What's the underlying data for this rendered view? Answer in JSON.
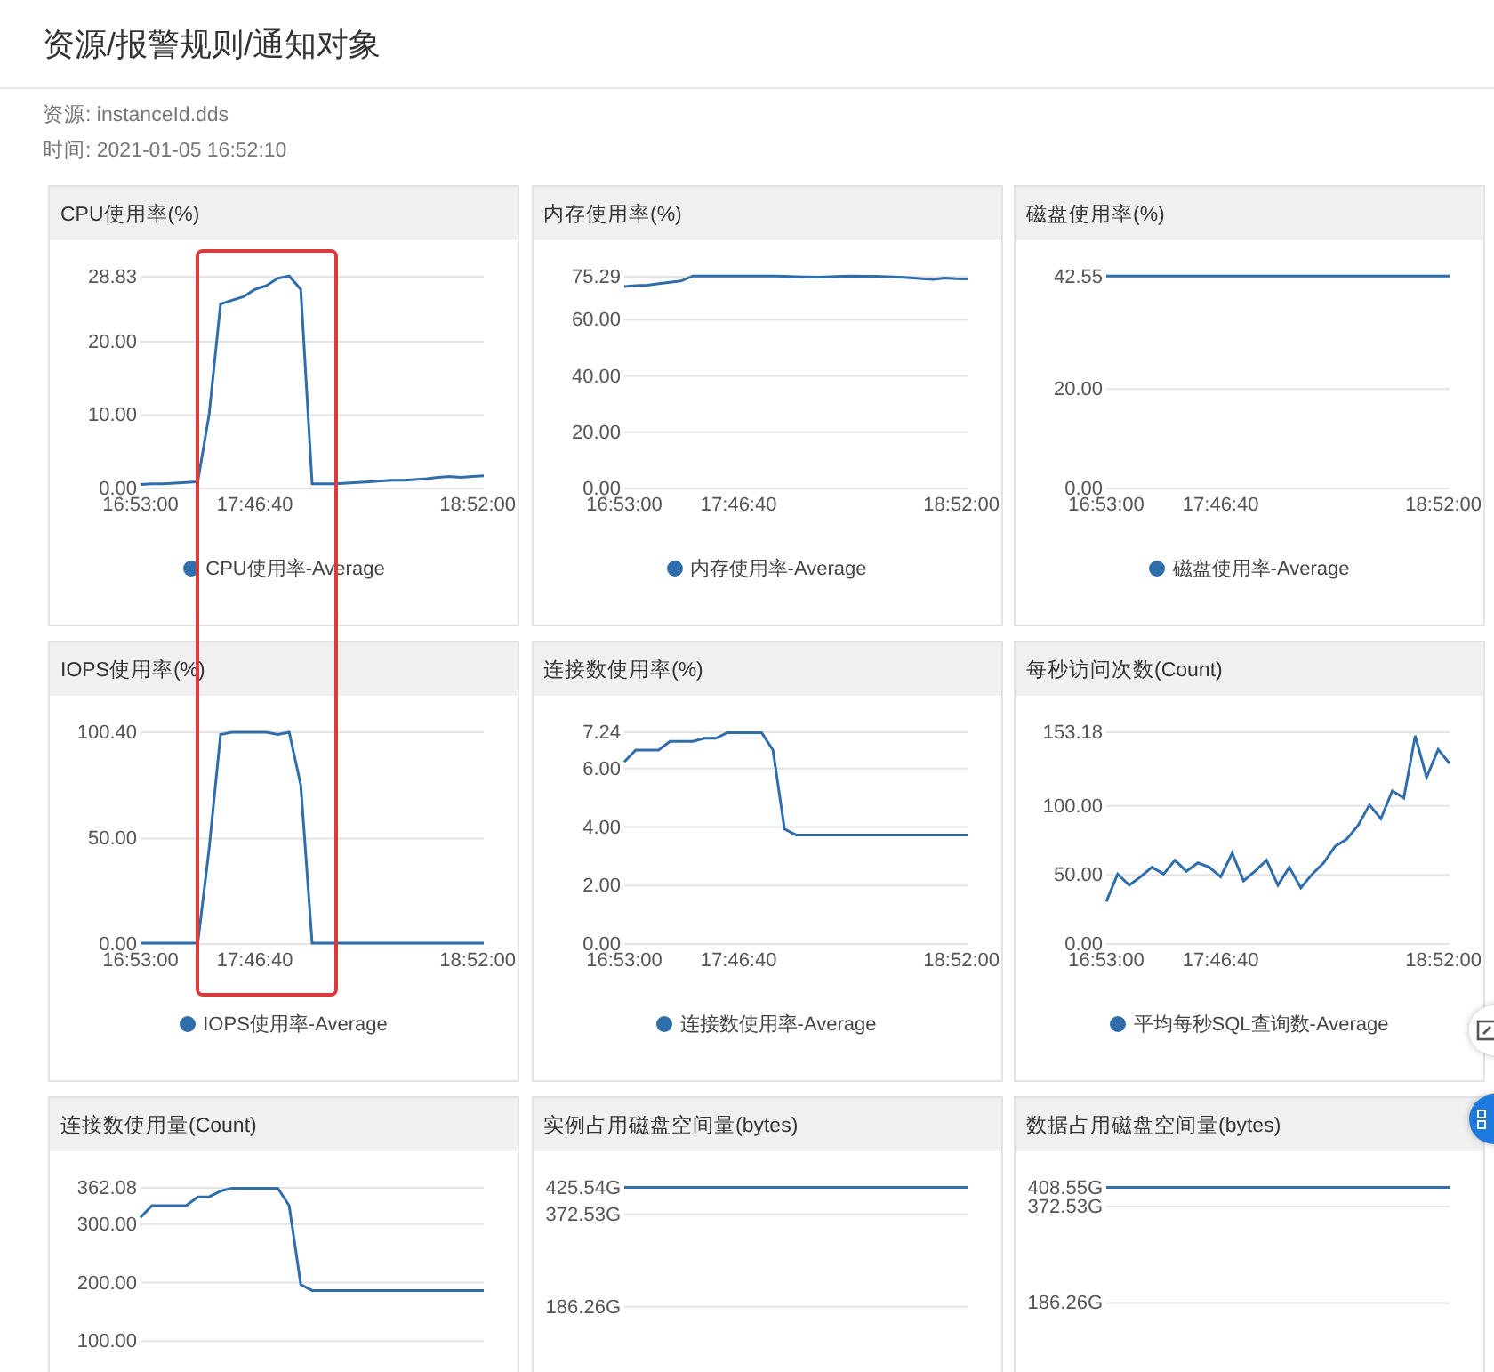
{
  "page_title": "资源/报警规则/通知对象",
  "meta": [
    "资源: instanceId.dds",
    "时间: 2021-01-05 16:52:10"
  ],
  "charts": [
    {
      "title": "CPU使用率(%)",
      "chart_data": {
        "type": "line",
        "grid": true,
        "categories": [
          "16:53:00",
          null,
          null,
          null,
          null,
          null,
          null,
          null,
          null,
          null,
          "17:46:40",
          null,
          null,
          null,
          null,
          null,
          null,
          null,
          null,
          null,
          null,
          null,
          null,
          null,
          null,
          null,
          null,
          null,
          null,
          null,
          "18:52:00"
        ],
        "ylim": [
          0,
          28.83
        ],
        "yticks": [
          {
            "value": 0,
            "label": "0.00"
          },
          {
            "value": 10,
            "label": "10.00"
          },
          {
            "value": 20,
            "label": "20.00"
          },
          {
            "value": 28.83,
            "label": "28.83"
          }
        ],
        "series": [
          {
            "name": "CPU使用率-Average",
            "color": "#2f6eab",
            "values": [
              0.4,
              0.5,
              0.5,
              0.6,
              0.7,
              0.8,
              10,
              25,
              25.5,
              26,
              27,
              27.5,
              28.5,
              28.8,
              27,
              0.5,
              0.5,
              0.5,
              0.6,
              0.7,
              0.8,
              0.9,
              1.0,
              1.0,
              1.1,
              1.2,
              1.4,
              1.5,
              1.4,
              1.5,
              1.6
            ]
          }
        ]
      }
    },
    {
      "title": "内存使用率(%)",
      "chart_data": {
        "type": "line",
        "grid": true,
        "categories": [
          "16:53:00",
          null,
          null,
          null,
          null,
          null,
          null,
          null,
          null,
          null,
          "17:46:40",
          null,
          null,
          null,
          null,
          null,
          null,
          null,
          null,
          null,
          null,
          null,
          null,
          null,
          null,
          null,
          null,
          null,
          null,
          null,
          "18:52:00"
        ],
        "ylim": [
          0,
          75.29
        ],
        "yticks": [
          {
            "value": 0,
            "label": "0.00"
          },
          {
            "value": 20,
            "label": "20.00"
          },
          {
            "value": 40,
            "label": "40.00"
          },
          {
            "value": 60,
            "label": "60.00"
          },
          {
            "value": 75.29,
            "label": "75.29"
          }
        ],
        "series": [
          {
            "name": "内存使用率-Average",
            "color": "#2f6eab",
            "values": [
              71.5,
              71.8,
              72,
              72.5,
              73,
              73.5,
              75.2,
              75.2,
              75.2,
              75.2,
              75.2,
              75.2,
              75.2,
              75.2,
              75.1,
              75,
              74.9,
              74.8,
              75,
              75.1,
              75.2,
              75.1,
              75.1,
              75,
              74.8,
              74.6,
              74.3,
              74,
              74.5,
              74.3,
              74.2
            ]
          }
        ]
      }
    },
    {
      "title": "磁盘使用率(%)",
      "chart_data": {
        "type": "line",
        "grid": true,
        "categories": [
          "16:53:00",
          null,
          null,
          null,
          null,
          null,
          null,
          null,
          null,
          null,
          "17:46:40",
          null,
          null,
          null,
          null,
          null,
          null,
          null,
          null,
          null,
          null,
          null,
          null,
          null,
          null,
          null,
          null,
          null,
          null,
          null,
          "18:52:00"
        ],
        "ylim": [
          0,
          42.55
        ],
        "yticks": [
          {
            "value": 0,
            "label": "0.00"
          },
          {
            "value": 20,
            "label": "20.00"
          },
          {
            "value": 42.55,
            "label": "42.55"
          }
        ],
        "series": [
          {
            "name": "磁盘使用率-Average",
            "color": "#2f6eab",
            "values": [
              42.5,
              42.5,
              42.5,
              42.5,
              42.5,
              42.5,
              42.5,
              42.5,
              42.5,
              42.5,
              42.5,
              42.5,
              42.5,
              42.5,
              42.5,
              42.5,
              42.5,
              42.5,
              42.5,
              42.5,
              42.5,
              42.5,
              42.5,
              42.5,
              42.5,
              42.5,
              42.5,
              42.5,
              42.5,
              42.5,
              42.5
            ]
          }
        ]
      }
    },
    {
      "title": "IOPS使用率(%)",
      "chart_data": {
        "type": "line",
        "grid": true,
        "categories": [
          "16:53:00",
          null,
          null,
          null,
          null,
          null,
          null,
          null,
          null,
          null,
          "17:46:40",
          null,
          null,
          null,
          null,
          null,
          null,
          null,
          null,
          null,
          null,
          null,
          null,
          null,
          null,
          null,
          null,
          null,
          null,
          null,
          "18:52:00"
        ],
        "ylim": [
          0,
          100.4
        ],
        "yticks": [
          {
            "value": 0,
            "label": "0.00"
          },
          {
            "value": 50,
            "label": "50.00"
          },
          {
            "value": 100.4,
            "label": "100.40"
          }
        ],
        "series": [
          {
            "name": "IOPS使用率-Average",
            "color": "#2f6eab",
            "values": [
              0,
              0,
              0,
              0,
              0,
              0,
              45,
              99,
              100,
              100,
              100,
              100,
              99,
              100,
              75,
              0,
              0,
              0,
              0,
              0,
              0,
              0,
              0,
              0,
              0,
              0,
              0,
              0,
              0,
              0,
              0
            ]
          }
        ]
      }
    },
    {
      "title": "连接数使用率(%)",
      "chart_data": {
        "type": "line",
        "grid": true,
        "categories": [
          "16:53:00",
          null,
          null,
          null,
          null,
          null,
          null,
          null,
          null,
          null,
          "17:46:40",
          null,
          null,
          null,
          null,
          null,
          null,
          null,
          null,
          null,
          null,
          null,
          null,
          null,
          null,
          null,
          null,
          null,
          null,
          null,
          "18:52:00"
        ],
        "ylim": [
          0,
          7.24
        ],
        "yticks": [
          {
            "value": 0,
            "label": "0.00"
          },
          {
            "value": 2,
            "label": "2.00"
          },
          {
            "value": 4,
            "label": "4.00"
          },
          {
            "value": 6,
            "label": "6.00"
          },
          {
            "value": 7.24,
            "label": "7.24"
          }
        ],
        "series": [
          {
            "name": "连接数使用率-Average",
            "color": "#2f6eab",
            "values": [
              6.2,
              6.6,
              6.6,
              6.6,
              6.9,
              6.9,
              6.9,
              7.0,
              7.0,
              7.2,
              7.2,
              7.2,
              7.2,
              6.6,
              3.9,
              3.7,
              3.7,
              3.7,
              3.7,
              3.7,
              3.7,
              3.7,
              3.7,
              3.7,
              3.7,
              3.7,
              3.7,
              3.7,
              3.7,
              3.7,
              3.7
            ]
          }
        ]
      }
    },
    {
      "title": "每秒访问次数(Count)",
      "chart_data": {
        "type": "line",
        "grid": true,
        "categories": [
          "16:53:00",
          null,
          null,
          null,
          null,
          null,
          null,
          null,
          null,
          null,
          "17:46:40",
          null,
          null,
          null,
          null,
          null,
          null,
          null,
          null,
          null,
          null,
          null,
          null,
          null,
          null,
          null,
          null,
          null,
          null,
          null,
          "18:52:00"
        ],
        "ylim": [
          0,
          153.18
        ],
        "yticks": [
          {
            "value": 0,
            "label": "0.00"
          },
          {
            "value": 50,
            "label": "50.00"
          },
          {
            "value": 100,
            "label": "100.00"
          },
          {
            "value": 153.18,
            "label": "153.18"
          }
        ],
        "series": [
          {
            "name": "平均每秒SQL查询数-Average",
            "color": "#2f6eab",
            "values": [
              30,
              50,
              42,
              48,
              55,
              50,
              60,
              52,
              58,
              55,
              48,
              65,
              45,
              52,
              60,
              42,
              55,
              40,
              50,
              58,
              70,
              75,
              85,
              100,
              90,
              110,
              105,
              150,
              120,
              140,
              130
            ]
          }
        ]
      }
    },
    {
      "title": "连接数使用量(Count)",
      "chart_data": {
        "type": "line",
        "grid": true,
        "categories": [
          null,
          null,
          null,
          null,
          null,
          null,
          null,
          null,
          null,
          null,
          null,
          null,
          null,
          null,
          null,
          null,
          null,
          null,
          null,
          null,
          null,
          null,
          null,
          null,
          null,
          null,
          null,
          null,
          null,
          null,
          null
        ],
        "ylim": [
          100,
          362.08
        ],
        "yticks": [
          {
            "value": 100,
            "label": "100.00"
          },
          {
            "value": 200,
            "label": "200.00"
          },
          {
            "value": 300,
            "label": "300.00"
          },
          {
            "value": 362.08,
            "label": "362.08"
          }
        ],
        "series": [
          {
            "color": "#2f6eab",
            "values": [
              310,
              330,
              330,
              330,
              330,
              345,
              345,
              355,
              360,
              360,
              360,
              360,
              360,
              330,
              195,
              185,
              185,
              185,
              185,
              185,
              185,
              185,
              185,
              185,
              185,
              185,
              185,
              185,
              185,
              185,
              185
            ]
          }
        ]
      }
    },
    {
      "title": "实例占用磁盘空间量(bytes)",
      "chart_data": {
        "type": "line",
        "grid": true,
        "categories": [
          null,
          null,
          null,
          null,
          null,
          null,
          null,
          null,
          null,
          null,
          null,
          null,
          null,
          null,
          null,
          null,
          null,
          null,
          null,
          null,
          null,
          null,
          null,
          null,
          null,
          null,
          null,
          null,
          null,
          null,
          null
        ],
        "ylim": [
          186.26,
          425.54
        ],
        "yticks": [
          {
            "value": 186.26,
            "label": "186.26G"
          },
          {
            "value": 372.53,
            "label": "372.53G"
          },
          {
            "value": 425.54,
            "label": "425.54G"
          }
        ],
        "series": [
          {
            "color": "#2f6eab",
            "values": [
              425,
              425,
              425,
              425,
              425,
              425,
              425,
              425,
              425,
              425,
              425,
              425,
              425,
              425,
              425,
              425,
              425,
              425,
              425,
              425,
              425,
              425,
              425,
              425,
              425,
              425,
              425,
              425,
              425,
              425,
              425
            ]
          }
        ]
      }
    },
    {
      "title": "数据占用磁盘空间量(bytes)",
      "chart_data": {
        "type": "line",
        "grid": true,
        "categories": [
          null,
          null,
          null,
          null,
          null,
          null,
          null,
          null,
          null,
          null,
          null,
          null,
          null,
          null,
          null,
          null,
          null,
          null,
          null,
          null,
          null,
          null,
          null,
          null,
          null,
          null,
          null,
          null,
          null,
          null,
          null
        ],
        "ylim": [
          186.26,
          408.55
        ],
        "yticks": [
          {
            "value": 186.26,
            "label": "186.26G"
          },
          {
            "value": 372.53,
            "label": "372.53G"
          },
          {
            "value": 408.55,
            "label": "408.55G"
          }
        ],
        "series": [
          {
            "color": "#2f6eab",
            "values": [
              408,
              408,
              408,
              408,
              408,
              408,
              408,
              408,
              408,
              408,
              408,
              408,
              408,
              408,
              408,
              408,
              408,
              408,
              408,
              408,
              408,
              408,
              408,
              408,
              408,
              408,
              408,
              408,
              408,
              408,
              408
            ]
          }
        ]
      }
    }
  ]
}
